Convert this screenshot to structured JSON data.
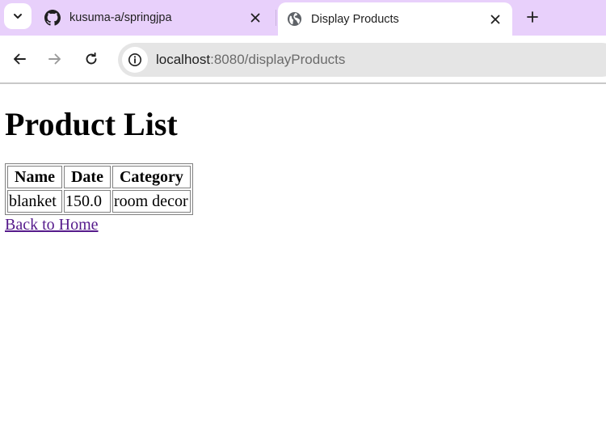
{
  "browser": {
    "tabs": [
      {
        "title": "kusuma-a/springjpa",
        "favicon": "github-icon",
        "active": false
      },
      {
        "title": "Display Products",
        "favicon": "globe-icon",
        "active": true
      }
    ],
    "url_host": "localhost",
    "url_path": ":8080/displayProducts"
  },
  "page": {
    "heading": "Product List",
    "table": {
      "headers": [
        "Name",
        "Date",
        "Category"
      ],
      "rows": [
        [
          "blanket",
          "150.0",
          "room decor"
        ]
      ]
    },
    "back_link": "Back to Home"
  }
}
